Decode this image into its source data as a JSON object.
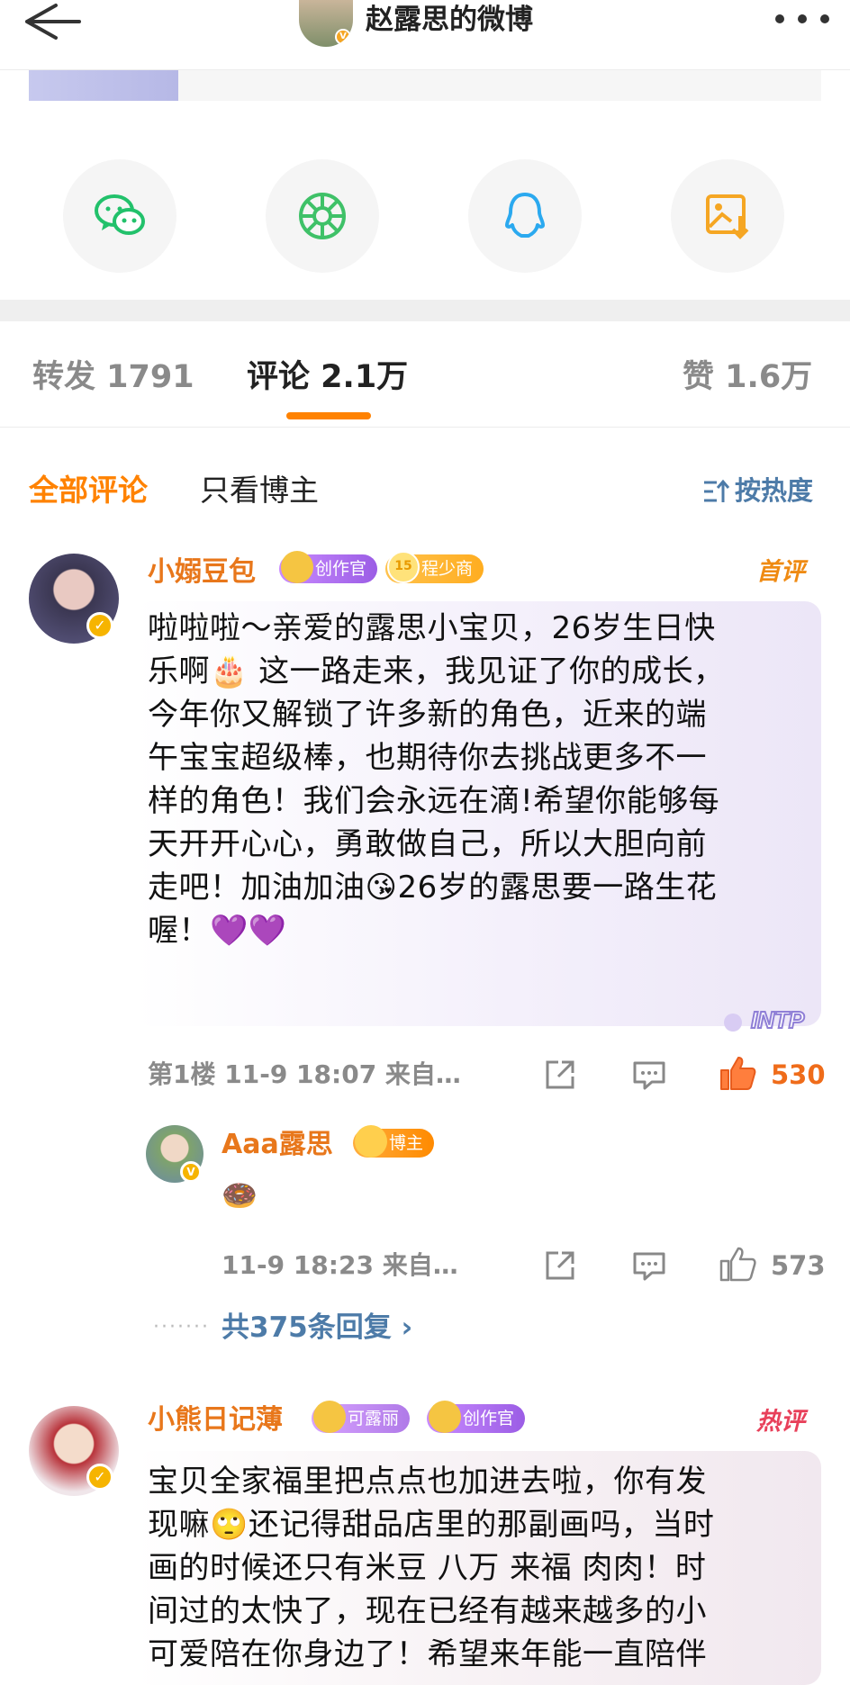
{
  "header": {
    "back_icon": "arrow-left-icon",
    "title": "赵露思的微博",
    "avatar_badge": "V",
    "more_icon": "more-dots-icon"
  },
  "share": {
    "items": [
      {
        "icon": "wechat-icon",
        "color": "#22c16b"
      },
      {
        "icon": "moments-icon",
        "color": "#3fc168"
      },
      {
        "icon": "qq-icon",
        "color": "#2ba9ef"
      },
      {
        "icon": "save-image-icon",
        "color": "#f5a623"
      }
    ]
  },
  "tabs": {
    "repost": "转发 1791",
    "comment": "评论 2.1万",
    "like": "赞 1.6万",
    "active": "comment",
    "accent": "#ff8200"
  },
  "filter": {
    "all": "全部评论",
    "owner_only": "只看博主",
    "sort": "按热度"
  },
  "comments": [
    {
      "user": "小嫋豆包",
      "badges": [
        "创作官",
        "程少商"
      ],
      "badge_level": "15",
      "tag": "首评",
      "text_lines": [
        "啦啦啦～亲爱的露思小宝贝，26岁生日快",
        "乐啊🎂 这一路走来，我见证了你的成长，",
        "今年你又解锁了许多新的角色，近来的端",
        "午宝宝超级棒，也期待你去挑战更多不一",
        "样的角色！我们会永远在滴!希望你能够每",
        "天开开心心，勇敢做自己，所以大胆向前",
        "走吧！加油加油😘26岁的露思要一路生花",
        "喔！💜💜"
      ],
      "bubble_sticker": "INTP",
      "meta": "第1楼 11-9 18:07 来自…",
      "likes": "530",
      "reply": {
        "user": "Aaa露思",
        "badge": "博主",
        "emoji": "🍩",
        "meta": "11-9 18:23 来自…",
        "likes": "573"
      },
      "more_replies": "共375条回复 ›"
    },
    {
      "user": "小熊日记薄",
      "badges": [
        "可露丽",
        "创作官"
      ],
      "tag": "热评",
      "text_lines": [
        "宝贝全家福里把点点也加进去啦，你有发",
        "现嘛🙄还记得甜品店里的那副画吗，当时",
        "画的时候还只有米豆 八万 来福 肉肉！时",
        "间过的太快了，现在已经有越来越多的小",
        "可爱陪在你身边了！希望来年能一直陪伴"
      ]
    }
  ]
}
